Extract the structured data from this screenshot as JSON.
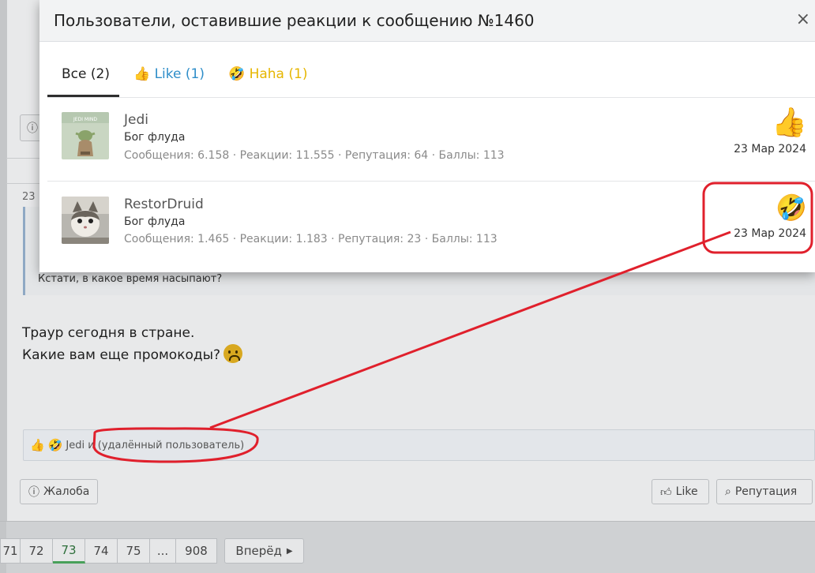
{
  "modal": {
    "title": "Пользователи, оставившие реакции к сообщению №1460",
    "close_symbol": "×",
    "tabs": [
      {
        "label": "Все (2)",
        "icon": "",
        "active": true
      },
      {
        "label": "Like (1)",
        "icon": "thumbs-up-icon",
        "active": false
      },
      {
        "label": "Haha (1)",
        "icon": "laughing-face-icon",
        "active": false
      }
    ],
    "users": [
      {
        "name": "Jedi",
        "title": "Бог флуда",
        "stats": "Сообщения: 6.158 · Реакции: 11.555 · Репутация: 64 · Баллы: 113",
        "reaction": "thumbs-up-icon",
        "date": "23 Мар 2024"
      },
      {
        "name": "RestorDruid",
        "title": "Бог флуда",
        "stats": "Сообщения: 1.465 · Реакции: 1.183 · Репутация: 23 · Баллы: 113",
        "reaction": "laughing-face-icon",
        "date": "23 Мар 2024"
      }
    ]
  },
  "post": {
    "date_fragment": "23",
    "quote_text": "Кстати, в какое время насыпают?",
    "lines": [
      "Траур сегодня в стране.",
      "Какие вам еще промокоды?"
    ],
    "reactions_summary": "Jedi и (удалённый пользователь)",
    "actions": {
      "report": "Жалоба",
      "like": "Like",
      "reputation": "Репутация"
    }
  },
  "pager": {
    "pages": [
      "71",
      "72",
      "73",
      "74",
      "75",
      "...",
      "908"
    ],
    "current": "73",
    "next_label": "Вперёд"
  },
  "colors": {
    "like_tab": "#2f8ec9",
    "haha_tab": "#e6b600",
    "annotation": "#e0202c",
    "active_page": "#48a05a"
  }
}
